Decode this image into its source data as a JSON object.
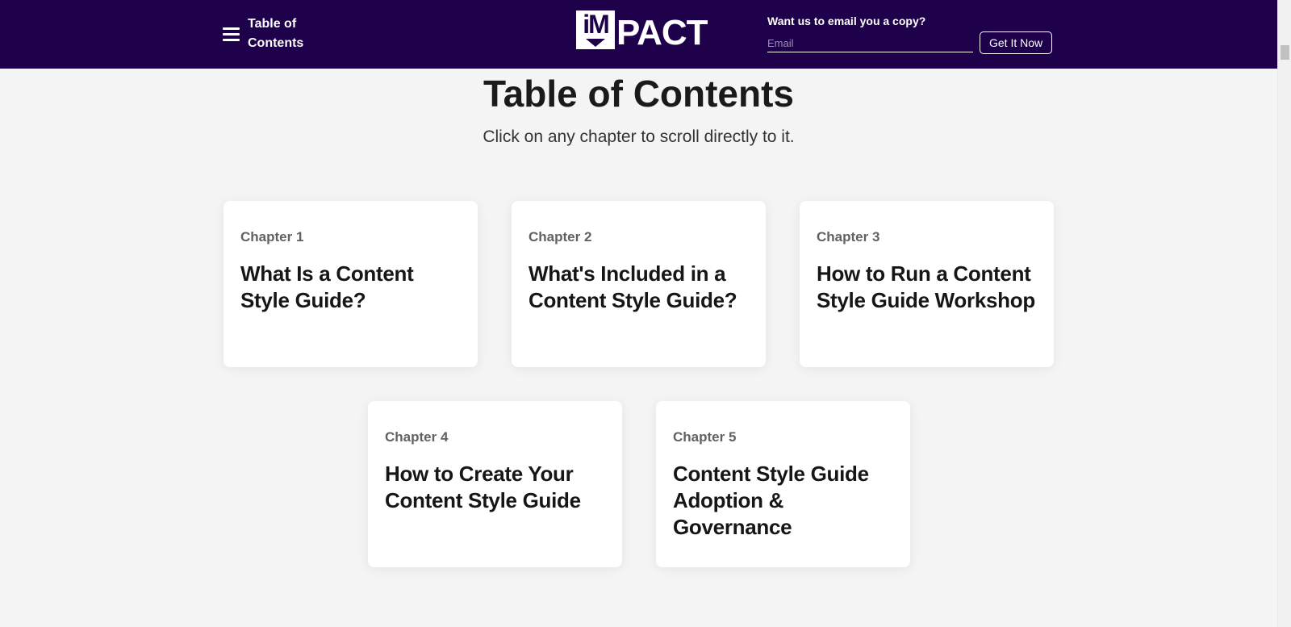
{
  "header": {
    "toc_label": "Table of Contents",
    "logo_box_text": "iM",
    "logo_text": "PACT",
    "email_prompt": "Want us to email you a copy?",
    "email_placeholder": "Email",
    "cta_label": "Get It Now"
  },
  "main": {
    "title": "Table of Contents",
    "subtitle": "Click on any chapter to scroll directly to it.",
    "chapters": [
      {
        "number": "Chapter 1",
        "title": "What Is a Content Style Guide?"
      },
      {
        "number": "Chapter 2",
        "title": "What's Included in a Content Style Guide?"
      },
      {
        "number": "Chapter 3",
        "title": "How to Run a Content Style Guide Workshop"
      },
      {
        "number": "Chapter 4",
        "title": "How to Create Your Content Style Guide"
      },
      {
        "number": "Chapter 5",
        "title": "Content Style Guide Adoption & Governance"
      }
    ]
  },
  "colors": {
    "header_bg": "#1e004b",
    "page_bg": "#f4f4f4",
    "card_bg": "#ffffff"
  }
}
